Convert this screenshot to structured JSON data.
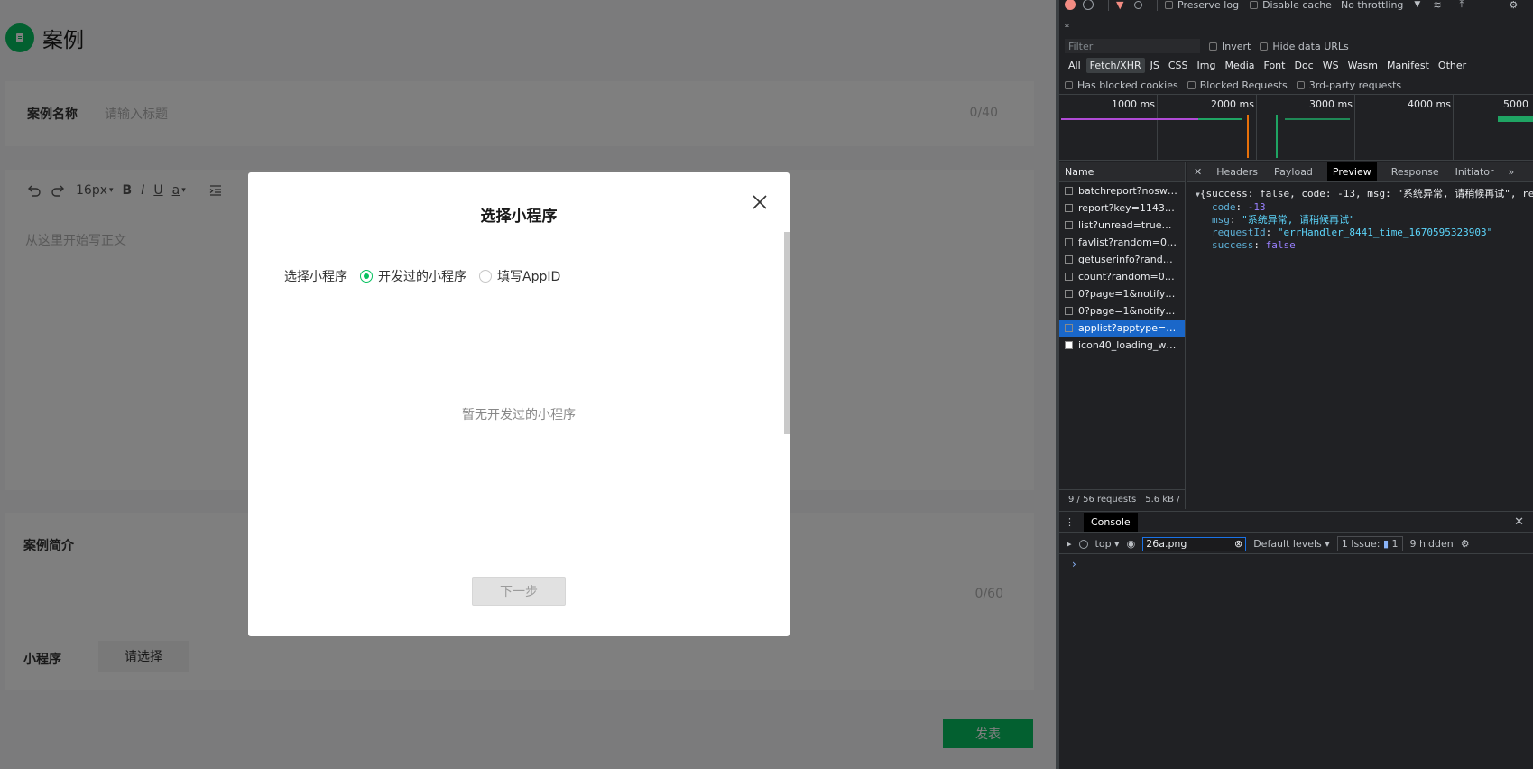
{
  "page": {
    "header_title": "案例",
    "title_label": "案例名称",
    "title_placeholder": "请输入标题",
    "title_count": "0/40",
    "toolbar_fontsize": "16px",
    "toolbar_bold": "B",
    "toolbar_italic": "I",
    "toolbar_underline": "U",
    "toolbar_color": "a",
    "editor_placeholder": "从这里开始写正文",
    "summary_label": "案例简介",
    "summary_count": "0/60",
    "miniprogram_label": "小程序",
    "choose_button": "请选择",
    "publish_button": "发表"
  },
  "modal": {
    "title": "选择小程序",
    "row_label": "选择小程序",
    "options": [
      {
        "label": "开发过的小程序",
        "checked": true
      },
      {
        "label": "填写AppID",
        "checked": false
      }
    ],
    "empty_text": "暂无开发过的小程序",
    "next_button": "下一步"
  },
  "devtools": {
    "toolbar": {
      "preserve_log": "Preserve log",
      "disable_cache": "Disable cache",
      "throttling": "No throttling"
    },
    "filter_placeholder": "Filter",
    "invert": "Invert",
    "hide_data_urls": "Hide data URLs",
    "types": [
      "All",
      "Fetch/XHR",
      "JS",
      "CSS",
      "Img",
      "Media",
      "Font",
      "Doc",
      "WS",
      "Wasm",
      "Manifest",
      "Other"
    ],
    "active_type": "Fetch/XHR",
    "extra_filters": [
      "Has blocked cookies",
      "Blocked Requests",
      "3rd-party requests"
    ],
    "timeline_ticks": [
      "1000 ms",
      "2000 ms",
      "3000 ms",
      "4000 ms",
      "5000"
    ],
    "name_header": "Name",
    "requests": [
      "batchreport?nosw=1",
      "report?key=114301_...",
      "list?unread=true&ra...",
      "favlist?random=0.78...",
      "getuserinfo?random...",
      "count?random=0.34...",
      "0?page=1&notifyTyp...",
      "0?page=1&notifyTyp...",
      "applist?apptype=1&...",
      "icon40_loading_whit..."
    ],
    "selected_request": 8,
    "footer_requests": "9 / 56 requests",
    "footer_size": "5.6 kB /",
    "detail_tabs": [
      "Headers",
      "Payload",
      "Preview",
      "Response",
      "Initiator"
    ],
    "active_detail_tab": "Preview",
    "preview": {
      "summary": "{success: false, code: -13, msg: \"系统异常, 请稍候再试\", req",
      "code_key": "code",
      "code_val": "-13",
      "msg_key": "msg",
      "msg_val": "\"系统异常, 请稍候再试\"",
      "requestId_key": "requestId",
      "requestId_val": "\"errHandler_8441_time_1670595323903\"",
      "success_key": "success",
      "success_val": "false"
    },
    "console": {
      "tab": "Console",
      "context": "top",
      "filter_value": "26a.png",
      "levels": "Default levels",
      "issues_label": "1 Issue:",
      "issues_count": "1",
      "hidden": "9 hidden"
    },
    "colors": {
      "accent_green": "#07c160",
      "devtools_bg": "#202124",
      "selection_blue": "#1a67c9"
    }
  }
}
